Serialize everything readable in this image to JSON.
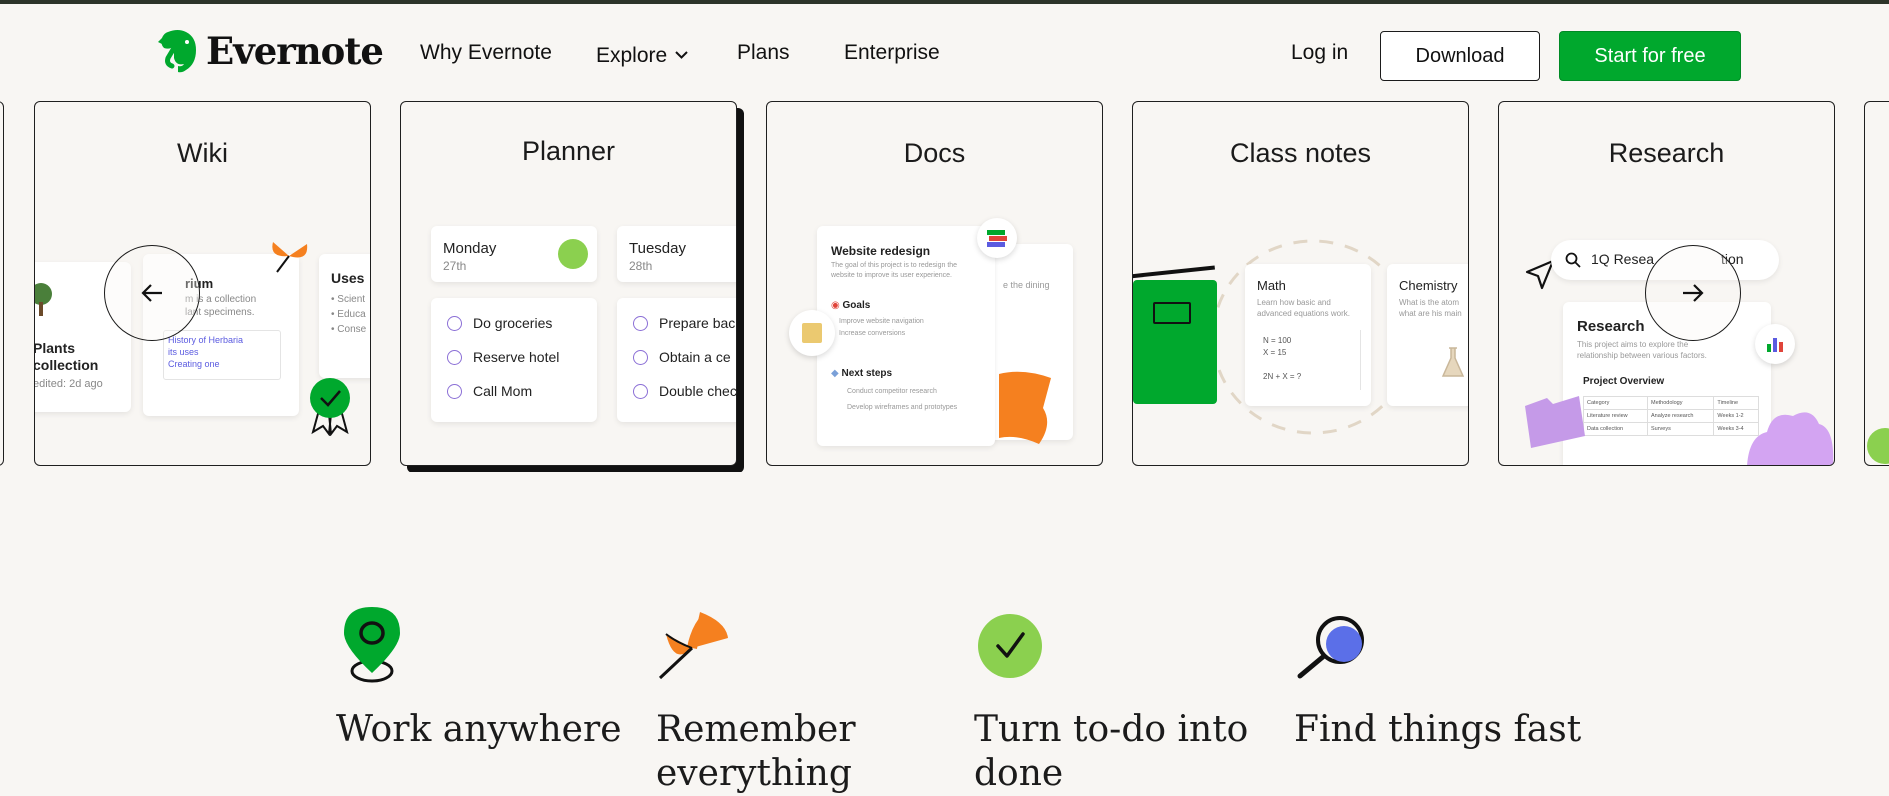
{
  "nav": {
    "brand": "Evernote",
    "links": [
      {
        "label": "Why Evernote"
      },
      {
        "label": "Explore"
      },
      {
        "label": "Plans"
      },
      {
        "label": "Enterprise"
      }
    ],
    "login": "Log in",
    "download": "Download",
    "start": "Start for free",
    "accent": "#00a82d"
  },
  "carousel": {
    "cards": [
      {
        "title": "Wiki"
      },
      {
        "title": "Planner"
      },
      {
        "title": "Docs"
      },
      {
        "title": "Class notes"
      },
      {
        "title": "Research"
      }
    ],
    "wiki": {
      "plants_title": "Plants",
      "plants_title2": "collection",
      "plants_edited": "edited: 2d ago",
      "herb_title": "rium",
      "herb_line1": "m is a collection",
      "herb_line2": "lant specimens.",
      "herb_link1": "History of Herbaria",
      "herb_link2": "its uses",
      "herb_link3": "Creating one",
      "uses_title": "Uses",
      "uses_1": "Scient",
      "uses_2": "Educa",
      "uses_3": "Conse"
    },
    "planner": {
      "day1": "Monday",
      "date1": "27th",
      "day2": "Tuesday",
      "date2": "28th",
      "tasks1": [
        "Do groceries",
        "Reserve hotel",
        "Call Mom"
      ],
      "tasks2": [
        "Prepare bac",
        "Obtain a ce",
        "Double chec"
      ]
    },
    "docs": {
      "title": "Website redesign",
      "desc1": "The goal of this project is to redesign the",
      "desc2": "website to improve its user experience.",
      "goals": "Goals",
      "goal1": "Improve website navigation",
      "goal2": "Increase conversions",
      "next": "Next steps",
      "step1": "Conduct competitor research",
      "step2": "Develop wireframes and prototypes",
      "side": "e the dining"
    },
    "class": {
      "math_title": "Math",
      "math_desc1": "Learn how basic and",
      "math_desc2": "advanced equations work.",
      "eq1": "N = 100",
      "eq2": "X = 15",
      "eq3": "2N + X = ?",
      "chem_title": "Chemistry",
      "chem_desc1": "What is the atom",
      "chem_desc2": "what are his main"
    },
    "research": {
      "search": "1Q Resea",
      "search_tail": "tion",
      "title": "Research",
      "desc1": "This project aims to explore the",
      "desc2": "relationship between various factors.",
      "overview": "Project Overview",
      "table_head": [
        "Category",
        "Methodology",
        "Timeline"
      ],
      "table_rows": [
        [
          "Literature review",
          "Analyze research",
          "Weeks 1-2"
        ],
        [
          "Data collection",
          "Surveys",
          "Weeks 3-4"
        ]
      ]
    }
  },
  "features": [
    {
      "title": "Work anywhere"
    },
    {
      "title": "Remember everything"
    },
    {
      "title": "Turn to-do into done"
    },
    {
      "title": "Find things fast"
    }
  ]
}
